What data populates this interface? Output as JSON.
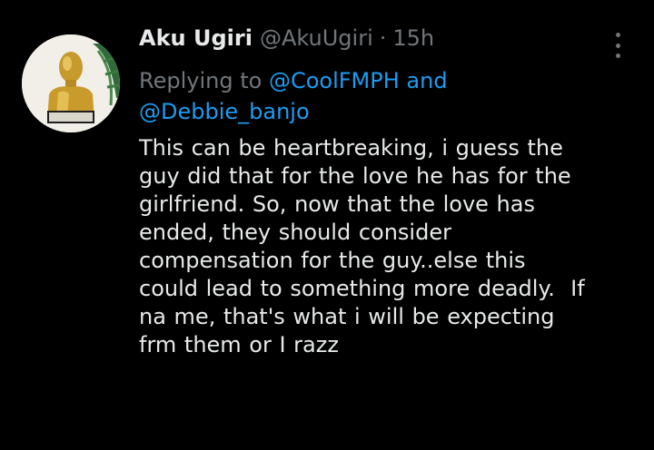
{
  "tweet": {
    "display_name": "Aku Ugiri",
    "handle": "@AkuUgiri",
    "separator": "·",
    "time": "15h",
    "replying_prefix": "Replying to",
    "mention_1": "@CoolFMPH",
    "and_word": "and",
    "mention_2": "@Debbie_banjo",
    "text_lines": [
      "This can be heartbreaking, i guess the",
      "guy did that for the love he has for the",
      "girlfriend. So, now that the love has",
      "ended, they should consider",
      "compensation for the guy..else this",
      "could lead to something more deadly.  If",
      "na me, that's what i will be expecting",
      "frm them or I razz"
    ]
  },
  "icons": {
    "avatar": "avatar-image",
    "more": "more-options-icon"
  },
  "colors": {
    "background": "#000000",
    "text": "#e7e9ea",
    "muted": "#71767b",
    "link": "#1d9bf0"
  }
}
